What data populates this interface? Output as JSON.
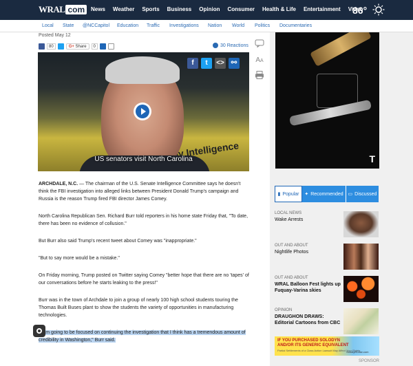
{
  "header": {
    "logo_main": "WRAL",
    "logo_suffix": "com",
    "nav": [
      "News",
      "Weather",
      "Sports",
      "Business",
      "Opinion",
      "Consumer",
      "Health & Life",
      "Entertainment",
      "Video"
    ],
    "temperature": "86°",
    "weather_icon": "sun-icon"
  },
  "subnav": [
    "Local",
    "State",
    "@NCCapitol",
    "Education",
    "Traffic",
    "Investigations",
    "Nation",
    "World",
    "Politics",
    "Documentaries"
  ],
  "article": {
    "posted": "Posted May 12",
    "fb_count": "80",
    "share_label": "Share",
    "share_count": "0",
    "reactions": "30 Reactions",
    "video_caption": "US senators visit North Carolina",
    "video_bg_text": "by Intelligence",
    "paragraphs": [
      {
        "lead": "ARCHDALE, N.C.",
        "text": " — The chairman of the U.S. Senate Intelligence Committee says he doesn't think the FBI investigation into alleged links between President Donald Trump's campaign and Russia is the reason Trump fired FBI director James Comey."
      },
      {
        "lead": "",
        "text": "North Carolina Republican Sen. Richard Burr told reporters in his home state Friday that, \"To date, there has been no evidence of collusion.\""
      },
      {
        "lead": "",
        "text": "But Burr also said Trump's recent tweet about Comey was \"inappropriate.\""
      },
      {
        "lead": "",
        "text": "\"But to say more would be a mistake.\""
      },
      {
        "lead": "",
        "text": "On Friday morning, Trump posted on Twitter saying Comey \"better hope that there are no 'tapes' of our conversations before he starts leaking to the press!\""
      },
      {
        "lead": "",
        "text": "Burr was in the town of Archdale to join a group of nearly 100 high school students touring the Thomas Built Buses plant to show the students the variety of opportunities in manufacturing technologies."
      }
    ],
    "highlighted": "\"I am going to be focused on continuing the investigation that I think has a tremendous amount of credibility in Washington,\" Burr said."
  },
  "sidebar": {
    "tabs": [
      "Popular",
      "Recommended",
      "Discussed"
    ],
    "stories": [
      {
        "category": "LOCAL NEWS",
        "headline": "Wake Arrests"
      },
      {
        "category": "OUT AND ABOUT",
        "headline": "Nightlife Photos"
      },
      {
        "category": "OUT AND ABOUT",
        "headline": "WRAL Balloon Fest lights up Fuquay-Varina skies"
      },
      {
        "category": "OPINION",
        "headline": "DRAUGHON DRAWS: Editorial Cartoons from CBC"
      }
    ],
    "ad1_letter": "T",
    "ad2": {
      "line1": "IF YOU PURCHASED SOLODYN",
      "line2": "AND/OR ITS GENERIC EQUIVALENT",
      "line3": "Partial Settlements of a Class Action Lawsuit May Affect Your Rights",
      "site": "SolodynCase.com"
    },
    "sponsor": "SPONSOR"
  },
  "colors": {
    "topbar": "#1a2a40",
    "link": "#2a6ab3",
    "tab_blue": "#2d8de0",
    "highlight": "#b9d4f1"
  }
}
